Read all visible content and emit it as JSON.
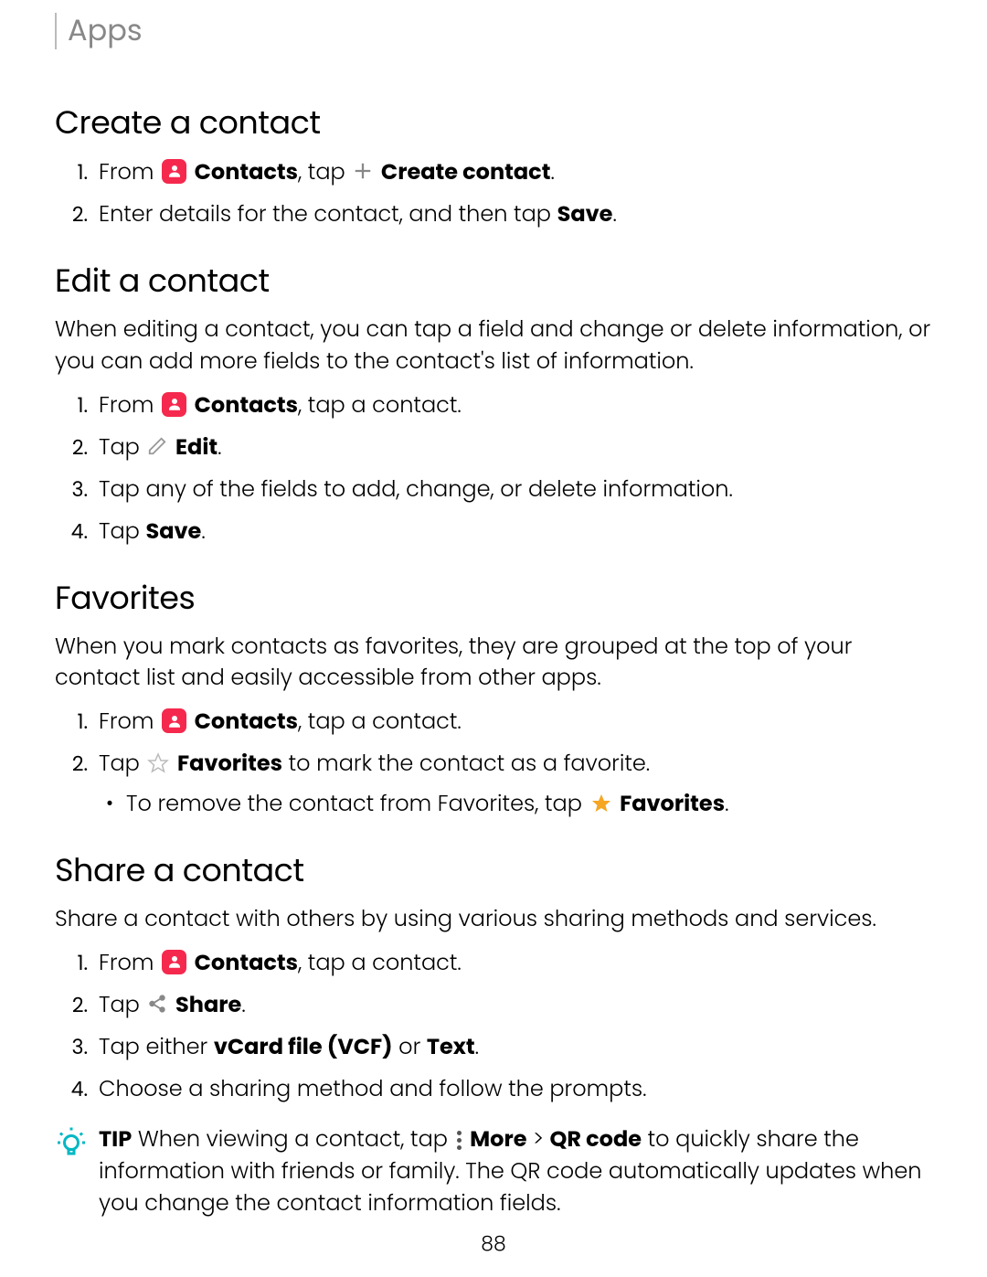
{
  "breadcrumb": "Apps",
  "pageNumber": "88",
  "sections": {
    "create": {
      "heading": "Create a contact",
      "step1_pre": "From ",
      "step1_contacts": "Contacts",
      "step1_mid": ", tap ",
      "step1_action": "Create contact",
      "step1_post": ".",
      "step2_pre": "Enter details for the contact, and then tap ",
      "step2_save": "Save",
      "step2_post": "."
    },
    "edit": {
      "heading": "Edit a contact",
      "desc": "When editing a contact, you can tap a field and change or delete information, or you can add more fields to the contact's list of information.",
      "step1_pre": "From ",
      "step1_contacts": "Contacts",
      "step1_post": ", tap a contact.",
      "step2_pre": "Tap ",
      "step2_edit": "Edit",
      "step2_post": ".",
      "step3": "Tap any of the fields to add, change, or delete information.",
      "step4_pre": "Tap ",
      "step4_save": "Save",
      "step4_post": "."
    },
    "favorites": {
      "heading": "Favorites",
      "desc": "When you mark contacts as favorites, they are grouped at the top of your contact list and easily accessible from other apps.",
      "step1_pre": "From ",
      "step1_contacts": "Contacts",
      "step1_post": ", tap a contact.",
      "step2_pre": "Tap ",
      "step2_fav": "Favorites",
      "step2_post": " to mark the contact as a favorite.",
      "bullet_pre": "To remove the contact from Favorites, tap ",
      "bullet_fav": "Favorites",
      "bullet_post": "."
    },
    "share": {
      "heading": "Share a contact",
      "desc": "Share a contact with others by using various sharing methods and services.",
      "step1_pre": "From ",
      "step1_contacts": "Contacts",
      "step1_post": ", tap a contact.",
      "step2_pre": "Tap ",
      "step2_share": "Share",
      "step2_post": ".",
      "step3_pre": "Tap either ",
      "step3_vcf": "vCard file (VCF)",
      "step3_mid": " or ",
      "step3_text": "Text",
      "step3_post": ".",
      "step4": "Choose a sharing method and follow the prompts."
    },
    "tip": {
      "label": "TIP",
      "pre": "  When viewing a contact, tap ",
      "more": "More",
      "gt": " > ",
      "qr": "QR code",
      "post": " to quickly share the information with friends or family. The QR code automatically updates when you change the contact information fields."
    }
  }
}
